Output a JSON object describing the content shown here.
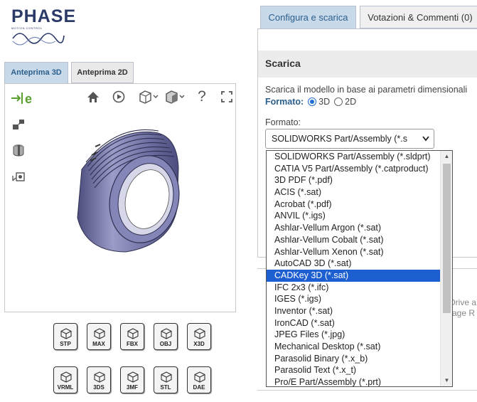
{
  "logo": {
    "name": "PHASE",
    "tagline": "MOTION CONTROL"
  },
  "preview_tabs": [
    {
      "label": "Anteprima 3D",
      "active": true
    },
    {
      "label": "Anteprima 2D",
      "active": false
    }
  ],
  "viewer": {
    "toolbar_icons": [
      "home-icon",
      "play-icon",
      "view-cube-icon",
      "shading-cube-icon",
      "help-icon",
      "fullscreen-icon"
    ],
    "help_label": "?",
    "side_icons": [
      "explode-icon",
      "section-icon",
      "measure-icon"
    ]
  },
  "formats_row1": [
    "STP",
    "MAX",
    "FBX",
    "OBJ",
    "X3D"
  ],
  "formats_row2": [
    "VRML",
    "3DS",
    "3MF",
    "STL",
    "DAE"
  ],
  "right_tabs": [
    {
      "label": "Configura e scarica",
      "active": true
    },
    {
      "label": "Votazioni & Commenti (0)",
      "active": false
    }
  ],
  "download": {
    "title": "Scarica",
    "description": "Scarica il modello in base ai parametri dimensionali",
    "format_type_label": "Formato:",
    "option_3d": "3D",
    "option_2d": "2D",
    "selected_type": "3D",
    "format_label": "Formato:",
    "selected_format": "SOLIDWORKS Part/Assembly (*.s",
    "side_text_1": "Drive a",
    "side_text_2": "rage R"
  },
  "dropdown_options": [
    "SOLIDWORKS Part/Assembly (*.sldprt)",
    "CATIA V5 Part/Assembly (*.catproduct)",
    "3D PDF (*.pdf)",
    "ACIS (*.sat)",
    "Acrobat (*.pdf)",
    "ANVIL (*.igs)",
    "Ashlar-Vellum Argon (*.sat)",
    "Ashlar-Vellum Cobalt (*.sat)",
    "Ashlar-Vellum Xenon (*.sat)",
    "AutoCAD 3D (*.sat)",
    "CADKey 3D (*.sat)",
    "IFC 2x3 (*.ifc)",
    "IGES (*.igs)",
    "Inventor (*.sat)",
    "IronCAD (*.sat)",
    "JPEG Files (*.jpg)",
    "Mechanical Desktop (*.sat)",
    "Parasolid Binary (*.x_b)",
    "Parasolid Text (*.x_t)",
    "Pro/E Part/Assembly (*.prt)"
  ],
  "highlighted_option": "CADKey 3D (*.sat)",
  "colors": {
    "accent": "#2b5f8d",
    "tab_active": "#c8d9e9",
    "highlight": "#1d5fd1",
    "ptc_green": "#5aa02c"
  }
}
